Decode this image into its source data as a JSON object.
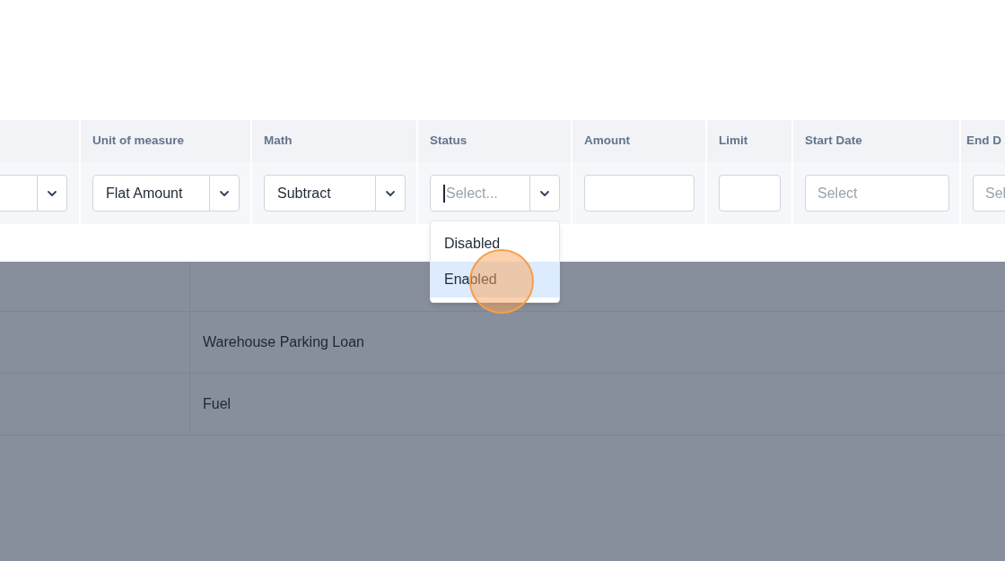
{
  "filter_row": [
    {
      "kind": "select"
    },
    {
      "header": "Unit of measure",
      "kind": "select",
      "value": "Flat Amount"
    },
    {
      "header": "Math",
      "kind": "select",
      "value": "Subtract"
    },
    {
      "header": "Status",
      "kind": "select",
      "placeholder": "Select...",
      "focused": true,
      "options": [
        {
          "label": "Disabled",
          "selected": false
        },
        {
          "label": "Enabled",
          "selected": true
        }
      ]
    },
    {
      "header": "Amount",
      "kind": "input"
    },
    {
      "header": "Limit",
      "kind": "input"
    },
    {
      "header": "Start Date",
      "kind": "date",
      "placeholder": "Select"
    },
    {
      "header": "End D",
      "kind": "date",
      "placeholder": "Sel"
    }
  ],
  "background_rows": [
    {
      "kind": "blank"
    },
    {
      "kind": "text",
      "column_2": "Warehouse Parking Loan"
    },
    {
      "kind": "text",
      "column_2": "Fuel"
    }
  ]
}
